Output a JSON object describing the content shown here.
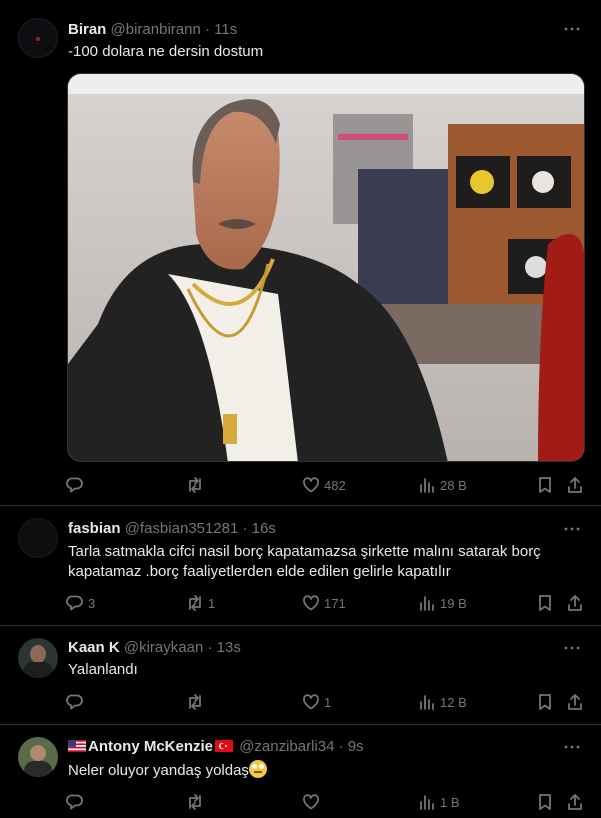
{
  "tweets": [
    {
      "name": "Biran",
      "handle": "@biranbirann",
      "time": "· 11s",
      "text": "-100 dolara ne dersin dostum",
      "stats": {
        "reply": "",
        "retweet": "",
        "like": "482",
        "views": "28 B"
      }
    },
    {
      "name": "fasbian",
      "handle": "@fasbian351281",
      "time": "· 16s",
      "text": "Tarla satmakla cifci nasil borç kapatamazsa şirkette malını satarak borç kapatamaz .borç faaliyetlerden elde edilen gelirle kapatılır",
      "stats": {
        "reply": "3",
        "retweet": "1",
        "like": "171",
        "views": "19 B"
      }
    },
    {
      "name": "Kaan K",
      "handle": "@kiraykaan",
      "time": "· 13s",
      "text": "Yalanlandı",
      "stats": {
        "reply": "",
        "retweet": "",
        "like": "1",
        "views": "12 B"
      }
    },
    {
      "name": "Antony McKenzie",
      "handle": "@zanzibarli34",
      "time": "· 9s",
      "text": "Neler oluyor yandaş yoldaş",
      "stats": {
        "reply": "",
        "retweet": "",
        "like": "",
        "views": "1 B"
      }
    }
  ],
  "icons": {
    "reply": "reply-icon",
    "retweet": "retweet-icon",
    "like": "heart-icon",
    "views": "views-icon",
    "bookmark": "bookmark-icon",
    "share": "share-icon",
    "more": "more-icon"
  },
  "colors": {
    "background": "#000000",
    "text": "#e7e9ea",
    "muted": "#71767b",
    "border": "#2f3336"
  }
}
